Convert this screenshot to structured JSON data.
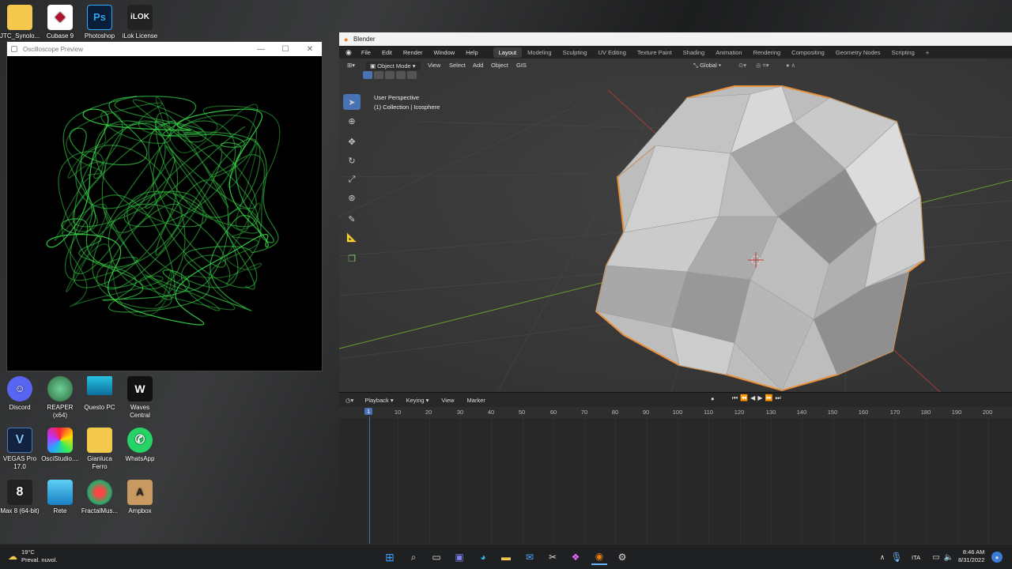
{
  "desktop": {
    "top_icons": [
      {
        "label": "JTC_Synolo...",
        "icon": "folder-icon"
      },
      {
        "label": "Cubase 9",
        "icon": "cubase-icon"
      },
      {
        "label": "Photoshop",
        "icon": "photoshop-icon"
      },
      {
        "label": "iLok License",
        "icon": "ilok-icon"
      }
    ],
    "icons": [
      {
        "label": "Discord",
        "icon": "discord-icon"
      },
      {
        "label": "REAPER (x64)",
        "icon": "reaper-icon"
      },
      {
        "label": "Questo PC",
        "icon": "computer-icon"
      },
      {
        "label": "Waves Central",
        "icon": "waves-icon"
      },
      {
        "label": "VEGAS Pro 17.0",
        "icon": "vegas-icon"
      },
      {
        "label": "OsciStudio....",
        "icon": "oscistudio-icon"
      },
      {
        "label": "Gianluca Ferro",
        "icon": "folder-icon"
      },
      {
        "label": "WhatsApp",
        "icon": "whatsapp-icon"
      },
      {
        "label": "Max 8 (64-bit)",
        "icon": "max-icon"
      },
      {
        "label": "Rete",
        "icon": "network-icon"
      },
      {
        "label": "FractalMus...",
        "icon": "fractal-icon"
      },
      {
        "label": "Ampbox",
        "icon": "ampbox-icon"
      }
    ]
  },
  "oscilloscope": {
    "title": "Oscilloscope Preview",
    "trace_color": "#39d94b"
  },
  "blender": {
    "title": "Blender",
    "menu": [
      "File",
      "Edit",
      "Render",
      "Window",
      "Help"
    ],
    "workspaces": [
      "Layout",
      "Modeling",
      "Sculpting",
      "UV Editing",
      "Texture Paint",
      "Shading",
      "Animation",
      "Rendering",
      "Compositing",
      "Geometry Nodes",
      "Scripting"
    ],
    "active_workspace": "Layout",
    "viewport": {
      "mode": "Object Mode",
      "menu": [
        "View",
        "Select",
        "Add",
        "Object",
        "GIS"
      ],
      "orientation": "Global",
      "overlay_line1": "User Perspective",
      "overlay_line2": "(1) Collection | Icosphere",
      "select_color": "#e8903a"
    },
    "timeline": {
      "menu": [
        "Playback",
        "Keying",
        "View",
        "Marker"
      ],
      "current_frame": "1",
      "ticks": [
        "10",
        "20",
        "30",
        "40",
        "50",
        "60",
        "70",
        "80",
        "90",
        "100",
        "110",
        "120",
        "130",
        "140",
        "150",
        "160",
        "170",
        "180",
        "190",
        "200"
      ]
    }
  },
  "taskbar": {
    "weather_temp": "19°C",
    "weather_desc": "Preval. nuvol.",
    "language": "ITA",
    "time": "8:46 AM",
    "date": "8/31/2022"
  }
}
